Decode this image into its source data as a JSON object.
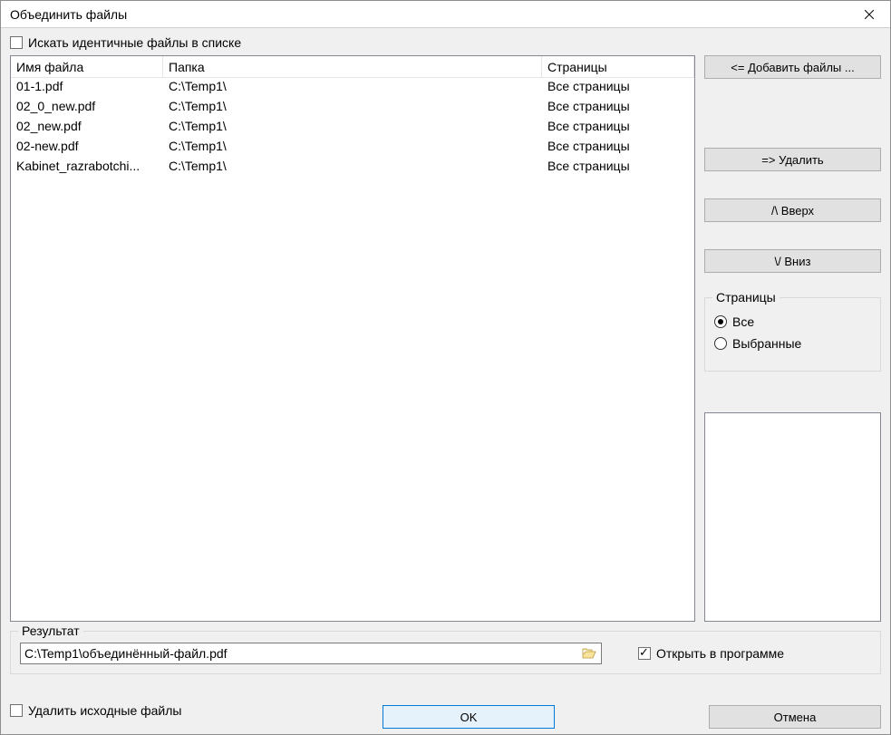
{
  "title": "Объединить файлы",
  "search_identical_label": "Искать идентичные файлы в списке",
  "columns": {
    "name": "Имя файла",
    "folder": "Папка",
    "pages": "Страницы"
  },
  "rows": [
    {
      "name": "01-1.pdf",
      "folder": "C:\\Temp1\\",
      "pages": "Все страницы"
    },
    {
      "name": "02_0_new.pdf",
      "folder": "C:\\Temp1\\",
      "pages": "Все страницы"
    },
    {
      "name": "02_new.pdf",
      "folder": "C:\\Temp1\\",
      "pages": "Все страницы"
    },
    {
      "name": "02-new.pdf",
      "folder": "C:\\Temp1\\",
      "pages": "Все страницы"
    },
    {
      "name": "Kabinet_razrabotchi...",
      "folder": "C:\\Temp1\\",
      "pages": "Все страницы"
    }
  ],
  "buttons": {
    "add": "<= Добавить файлы ...",
    "remove": "=> Удалить",
    "up": "/\\  Вверх",
    "down": "\\/  Вниз",
    "ok": "OK",
    "cancel": "Отмена"
  },
  "pages_group": {
    "title": "Страницы",
    "all": "Все",
    "selected": "Выбранные"
  },
  "result": {
    "title": "Результат",
    "path": "C:\\Temp1\\объединённый-файл.pdf",
    "open_label": "Открыть в программе"
  },
  "delete_source_label": "Удалить исходные файлы"
}
